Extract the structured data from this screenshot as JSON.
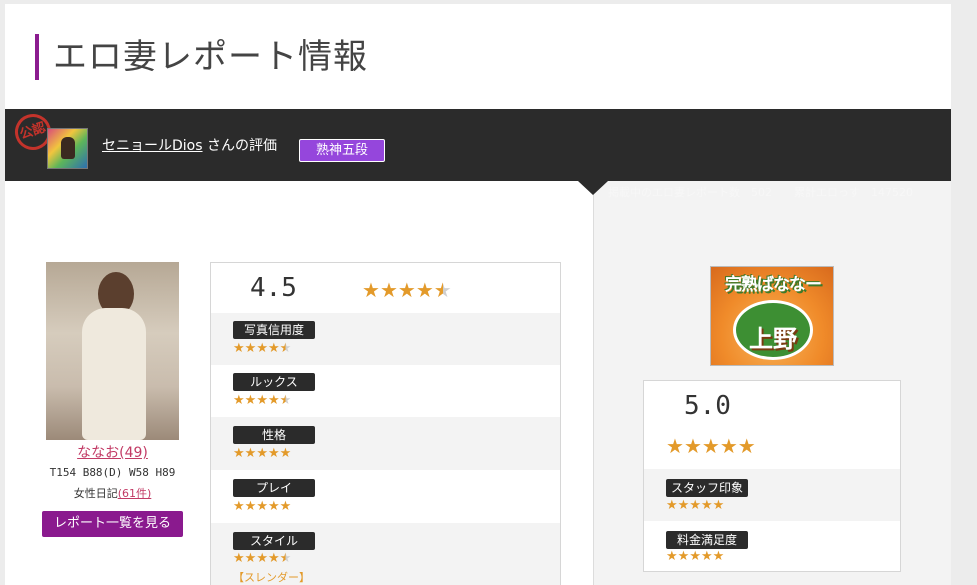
{
  "page": {
    "title": "エロ妻レポート情報"
  },
  "reviewer_bar": {
    "reviewer_name": "セニョールDios",
    "suffix": " さんの評価",
    "rank_badge": "熟神五段",
    "stats_text": "掲載中のエロ妻レポート数　502　　累計エロっす　147520"
  },
  "girl": {
    "name": "ななお(49)",
    "spec": "T154 B88(D) W58 H89",
    "diary_label": "女性日記",
    "diary_count": "(61件)",
    "report_button": "レポート一覧を見る"
  },
  "girl_rating": {
    "overall": "4.5",
    "overall_stars": 4.5,
    "categories": [
      {
        "label": "写真信用度",
        "stars": 4.5
      },
      {
        "label": "ルックス",
        "stars": 4.5
      },
      {
        "label": "性格",
        "stars": 5
      },
      {
        "label": "プレイ",
        "stars": 5
      },
      {
        "label": "スタイル",
        "stars": 4.5,
        "note": "【スレンダー】"
      }
    ]
  },
  "shop": {
    "logo_text_top": "完熟ばななー",
    "logo_text_main": "上野",
    "overall": "5.0",
    "overall_stars": 5,
    "categories": [
      {
        "label": "スタッフ印象",
        "stars": 5
      },
      {
        "label": "料金満足度",
        "stars": 5
      }
    ]
  },
  "colors": {
    "accent_purple": "#8b1c8f",
    "badge_purple": "#9546dc",
    "star_orange": "#e39a2a",
    "dark_bar": "#2b2b2b",
    "name_pink": "#c23a65"
  }
}
